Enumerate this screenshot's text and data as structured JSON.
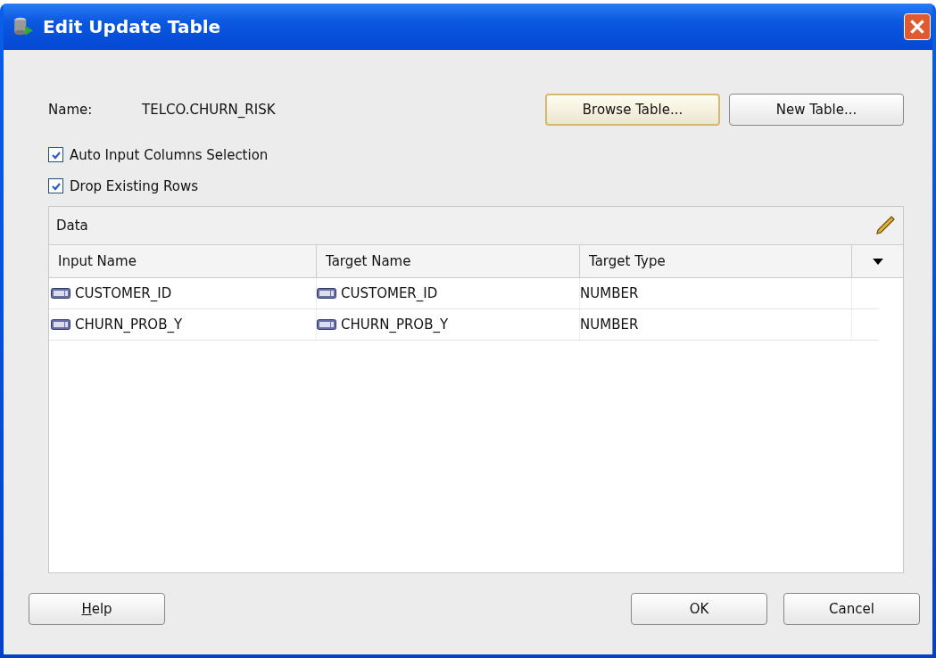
{
  "window": {
    "title": "Edit Update Table"
  },
  "name_field": {
    "label": "Name:",
    "value": "TELCO.CHURN_RISK"
  },
  "top_buttons": [
    {
      "label": "Browse Table...",
      "focused": true
    },
    {
      "label": "New Table...",
      "focused": false
    }
  ],
  "options": [
    {
      "label": "Auto Input Columns Selection",
      "checked": true
    },
    {
      "label": "Drop Existing Rows",
      "checked": true
    }
  ],
  "table": {
    "title": "Data",
    "columns": [
      "Input Name",
      "Target Name",
      "Target Type"
    ],
    "rows": [
      [
        "CUSTOMER_ID",
        "CUSTOMER_ID",
        "NUMBER"
      ],
      [
        "CHURN_PROB_Y",
        "CHURN_PROB_Y",
        "NUMBER"
      ]
    ]
  },
  "bottom_buttons": [
    {
      "underlined": "H",
      "rest": "elp",
      "kind": "left"
    },
    {
      "rest": "OK",
      "kind": "right"
    },
    {
      "rest": "Cancel",
      "kind": "right"
    }
  ]
}
